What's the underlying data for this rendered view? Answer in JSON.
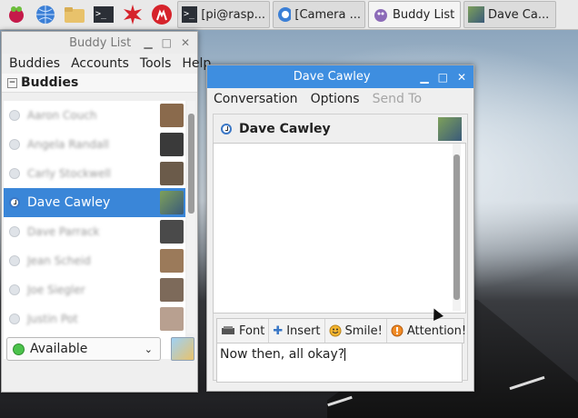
{
  "taskbar": {
    "launchers": [
      "raspberry-icon",
      "globe-icon",
      "folder-icon",
      "terminal-icon",
      "burst-icon",
      "wolfram-icon"
    ],
    "tasks": [
      {
        "label": "[pi@rasp...",
        "icon": "terminal-icon"
      },
      {
        "label": "[Camera ...",
        "icon": "chromium-icon"
      },
      {
        "label": "Buddy List",
        "icon": "pidgin-icon"
      },
      {
        "label": "Dave Ca...",
        "icon": "buddy-photo-icon"
      }
    ]
  },
  "buddy_list": {
    "title": "Buddy List",
    "menu": [
      "Buddies",
      "Accounts",
      "Tools",
      "Help"
    ],
    "group": {
      "name": "Buddies",
      "expander": "−"
    },
    "buddies": [
      {
        "name": "Aaron Couch",
        "avatar_color": "#8a6a4c"
      },
      {
        "name": "Angela Randall",
        "avatar_color": "#3a3a3a"
      },
      {
        "name": "Carly Stockwell",
        "avatar_color": "#6b5b4a"
      },
      {
        "name": "Dave Cawley",
        "avatar_color": "#5a7a4a",
        "selected": true
      },
      {
        "name": "Dave Parrack",
        "avatar_color": "#4a4a4a"
      },
      {
        "name": "Jean Scheid",
        "avatar_color": "#9b7a5a"
      },
      {
        "name": "Joe Siegler",
        "avatar_color": "#7d6a5a"
      },
      {
        "name": "Justin Pot",
        "avatar_color": "#b8a090"
      }
    ],
    "status": "Available",
    "status_color": "#4bc24b"
  },
  "conversation": {
    "title": "Dave Cawley",
    "menu": [
      {
        "label": "Conversation",
        "enabled": true
      },
      {
        "label": "Options",
        "enabled": true
      },
      {
        "label": "Send To",
        "enabled": false
      }
    ],
    "contact_name": "Dave Cawley",
    "formatting": [
      {
        "label": "Font",
        "icon": "font-icon"
      },
      {
        "label": "Insert",
        "icon": "insert-icon"
      },
      {
        "label": "Smile!",
        "icon": "smiley-icon"
      },
      {
        "label": "Attention!",
        "icon": "attention-icon"
      }
    ],
    "draft_message": "Now then, all okay?",
    "accent_color": "#3e8ee0"
  }
}
